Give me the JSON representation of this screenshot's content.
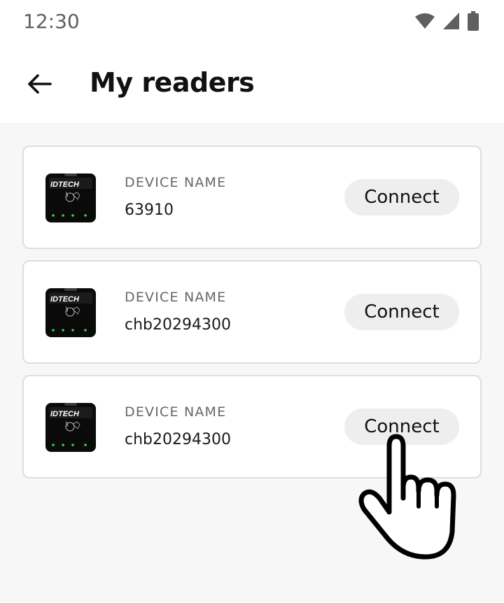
{
  "status_bar": {
    "time": "12:30",
    "icons": [
      "wifi-icon",
      "cell-signal-icon",
      "battery-icon"
    ]
  },
  "app_bar": {
    "back_icon": "arrow-left-icon",
    "title": "My readers"
  },
  "readers": [
    {
      "label": "DEVICE NAME",
      "name": "63910",
      "button": "Connect",
      "brand": "IDTECH"
    },
    {
      "label": "DEVICE NAME",
      "name": "chb20294300",
      "button": "Connect",
      "brand": "IDTECH"
    },
    {
      "label": "DEVICE NAME",
      "name": "chb20294300",
      "button": "Connect",
      "brand": "IDTECH"
    }
  ],
  "colors": {
    "background": "#f7f7f7",
    "card": "#ffffff",
    "button_bg": "#eeeeee",
    "led_green": "#3ecf4a"
  }
}
